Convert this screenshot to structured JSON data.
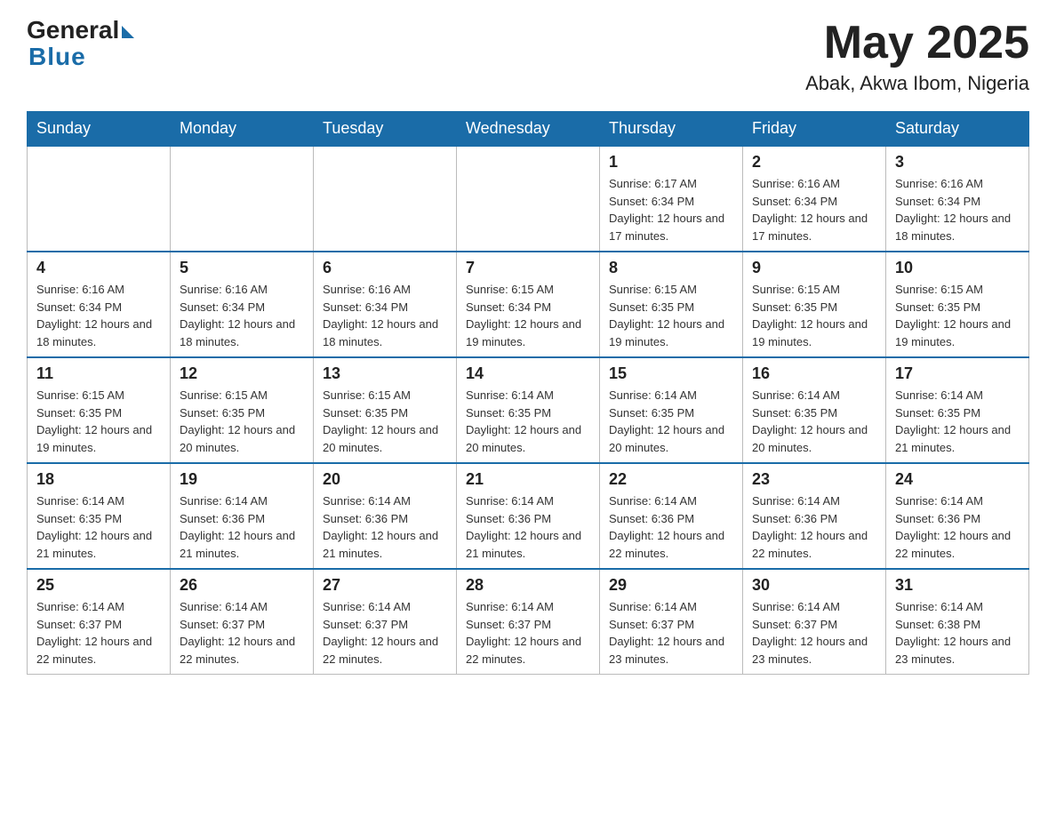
{
  "header": {
    "logo_general": "General",
    "logo_blue": "Blue",
    "month_year": "May 2025",
    "location": "Abak, Akwa Ibom, Nigeria"
  },
  "days_of_week": [
    "Sunday",
    "Monday",
    "Tuesday",
    "Wednesday",
    "Thursday",
    "Friday",
    "Saturday"
  ],
  "weeks": [
    [
      {
        "day": "",
        "info": ""
      },
      {
        "day": "",
        "info": ""
      },
      {
        "day": "",
        "info": ""
      },
      {
        "day": "",
        "info": ""
      },
      {
        "day": "1",
        "info": "Sunrise: 6:17 AM\nSunset: 6:34 PM\nDaylight: 12 hours and 17 minutes."
      },
      {
        "day": "2",
        "info": "Sunrise: 6:16 AM\nSunset: 6:34 PM\nDaylight: 12 hours and 17 minutes."
      },
      {
        "day": "3",
        "info": "Sunrise: 6:16 AM\nSunset: 6:34 PM\nDaylight: 12 hours and 18 minutes."
      }
    ],
    [
      {
        "day": "4",
        "info": "Sunrise: 6:16 AM\nSunset: 6:34 PM\nDaylight: 12 hours and 18 minutes."
      },
      {
        "day": "5",
        "info": "Sunrise: 6:16 AM\nSunset: 6:34 PM\nDaylight: 12 hours and 18 minutes."
      },
      {
        "day": "6",
        "info": "Sunrise: 6:16 AM\nSunset: 6:34 PM\nDaylight: 12 hours and 18 minutes."
      },
      {
        "day": "7",
        "info": "Sunrise: 6:15 AM\nSunset: 6:34 PM\nDaylight: 12 hours and 19 minutes."
      },
      {
        "day": "8",
        "info": "Sunrise: 6:15 AM\nSunset: 6:35 PM\nDaylight: 12 hours and 19 minutes."
      },
      {
        "day": "9",
        "info": "Sunrise: 6:15 AM\nSunset: 6:35 PM\nDaylight: 12 hours and 19 minutes."
      },
      {
        "day": "10",
        "info": "Sunrise: 6:15 AM\nSunset: 6:35 PM\nDaylight: 12 hours and 19 minutes."
      }
    ],
    [
      {
        "day": "11",
        "info": "Sunrise: 6:15 AM\nSunset: 6:35 PM\nDaylight: 12 hours and 19 minutes."
      },
      {
        "day": "12",
        "info": "Sunrise: 6:15 AM\nSunset: 6:35 PM\nDaylight: 12 hours and 20 minutes."
      },
      {
        "day": "13",
        "info": "Sunrise: 6:15 AM\nSunset: 6:35 PM\nDaylight: 12 hours and 20 minutes."
      },
      {
        "day": "14",
        "info": "Sunrise: 6:14 AM\nSunset: 6:35 PM\nDaylight: 12 hours and 20 minutes."
      },
      {
        "day": "15",
        "info": "Sunrise: 6:14 AM\nSunset: 6:35 PM\nDaylight: 12 hours and 20 minutes."
      },
      {
        "day": "16",
        "info": "Sunrise: 6:14 AM\nSunset: 6:35 PM\nDaylight: 12 hours and 20 minutes."
      },
      {
        "day": "17",
        "info": "Sunrise: 6:14 AM\nSunset: 6:35 PM\nDaylight: 12 hours and 21 minutes."
      }
    ],
    [
      {
        "day": "18",
        "info": "Sunrise: 6:14 AM\nSunset: 6:35 PM\nDaylight: 12 hours and 21 minutes."
      },
      {
        "day": "19",
        "info": "Sunrise: 6:14 AM\nSunset: 6:36 PM\nDaylight: 12 hours and 21 minutes."
      },
      {
        "day": "20",
        "info": "Sunrise: 6:14 AM\nSunset: 6:36 PM\nDaylight: 12 hours and 21 minutes."
      },
      {
        "day": "21",
        "info": "Sunrise: 6:14 AM\nSunset: 6:36 PM\nDaylight: 12 hours and 21 minutes."
      },
      {
        "day": "22",
        "info": "Sunrise: 6:14 AM\nSunset: 6:36 PM\nDaylight: 12 hours and 22 minutes."
      },
      {
        "day": "23",
        "info": "Sunrise: 6:14 AM\nSunset: 6:36 PM\nDaylight: 12 hours and 22 minutes."
      },
      {
        "day": "24",
        "info": "Sunrise: 6:14 AM\nSunset: 6:36 PM\nDaylight: 12 hours and 22 minutes."
      }
    ],
    [
      {
        "day": "25",
        "info": "Sunrise: 6:14 AM\nSunset: 6:37 PM\nDaylight: 12 hours and 22 minutes."
      },
      {
        "day": "26",
        "info": "Sunrise: 6:14 AM\nSunset: 6:37 PM\nDaylight: 12 hours and 22 minutes."
      },
      {
        "day": "27",
        "info": "Sunrise: 6:14 AM\nSunset: 6:37 PM\nDaylight: 12 hours and 22 minutes."
      },
      {
        "day": "28",
        "info": "Sunrise: 6:14 AM\nSunset: 6:37 PM\nDaylight: 12 hours and 22 minutes."
      },
      {
        "day": "29",
        "info": "Sunrise: 6:14 AM\nSunset: 6:37 PM\nDaylight: 12 hours and 23 minutes."
      },
      {
        "day": "30",
        "info": "Sunrise: 6:14 AM\nSunset: 6:37 PM\nDaylight: 12 hours and 23 minutes."
      },
      {
        "day": "31",
        "info": "Sunrise: 6:14 AM\nSunset: 6:38 PM\nDaylight: 12 hours and 23 minutes."
      }
    ]
  ]
}
